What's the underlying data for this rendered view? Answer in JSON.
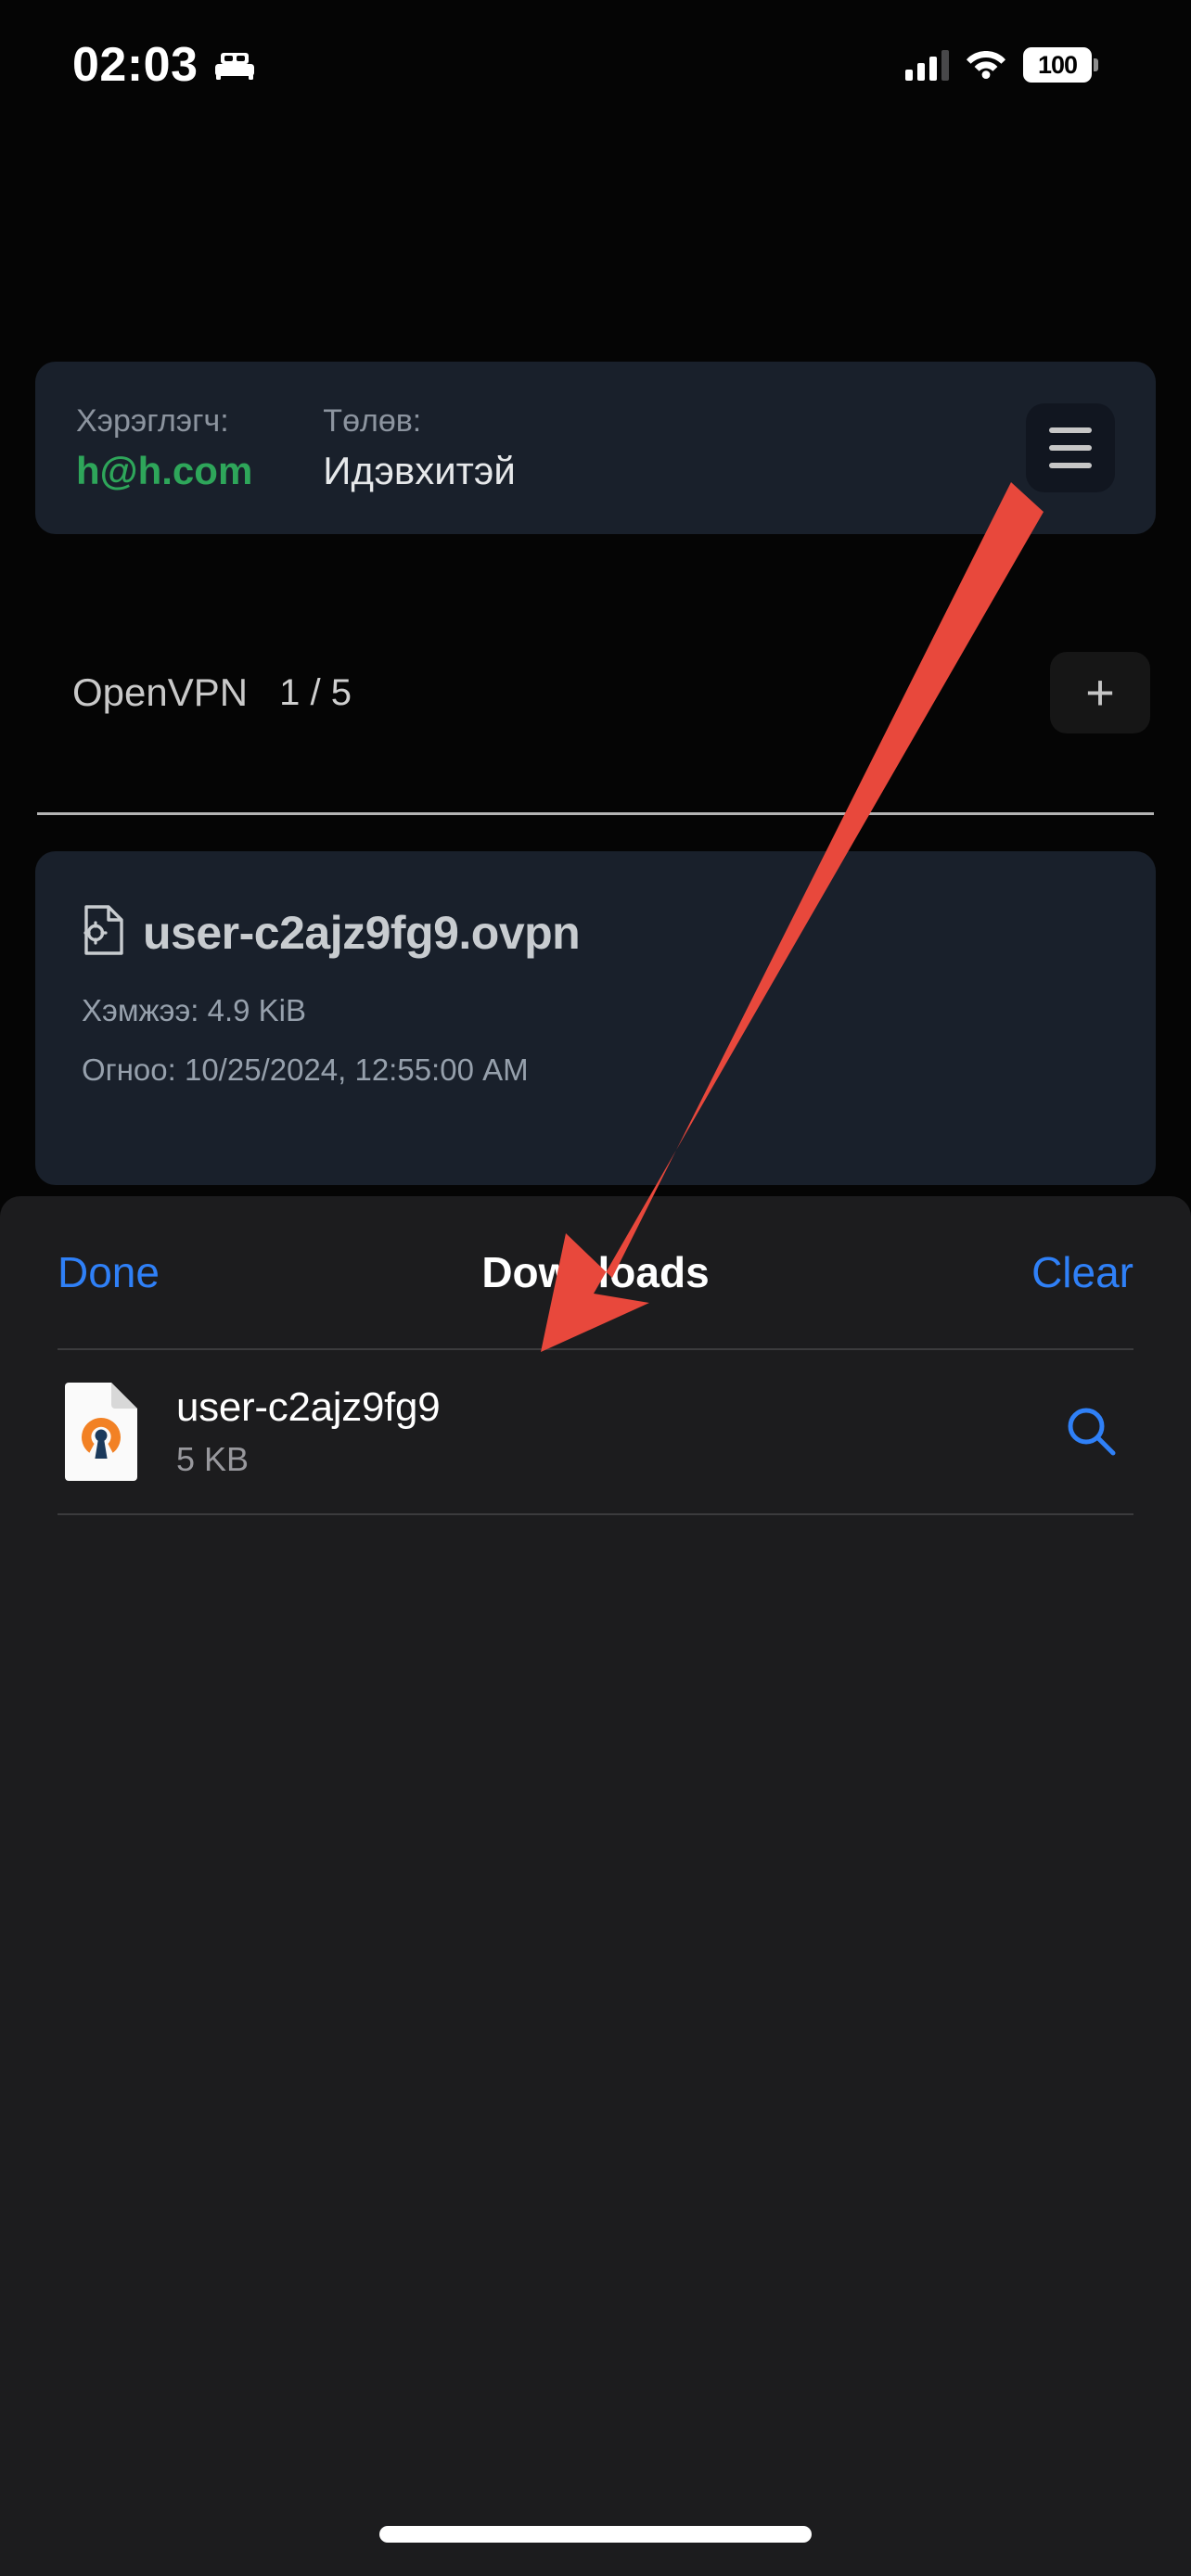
{
  "status_bar": {
    "time": "02:03",
    "sleep_icon": "bed-icon",
    "signal_icon": "cellular-signal-icon",
    "wifi_icon": "wifi-icon",
    "battery_level": "100"
  },
  "account_card": {
    "user_label": "Хэрэглэгч:",
    "user_value": "h@h.com",
    "status_label": "Төлөв:",
    "status_value": "Идэвхитэй",
    "menu_icon": "hamburger-menu-icon",
    "background_color": "#19202b",
    "user_value_color": "#2ea65a"
  },
  "section": {
    "title": "OpenVPN",
    "count": "1 / 5",
    "add_label": "+"
  },
  "profile_card": {
    "file_icon": "document-gear-icon",
    "filename": "user-c2ajz9fg9.ovpn",
    "size_text": "Хэмжээ: 4.9 KiB",
    "date_text": "Огноо: 10/25/2024, 12:55:00 AM"
  },
  "downloads_sheet": {
    "done_label": "Done",
    "title": "Downloads",
    "clear_label": "Clear",
    "accent_color": "#2f80f7",
    "background_color": "#1c1c1e",
    "items": [
      {
        "icon": "openvpn-file-icon",
        "name": "user-c2ajz9fg9",
        "size": "5 KB",
        "action_icon": "search-icon"
      }
    ]
  },
  "annotation": {
    "arrow_icon": "red-arrow-annotation",
    "color": "#e8483c"
  }
}
